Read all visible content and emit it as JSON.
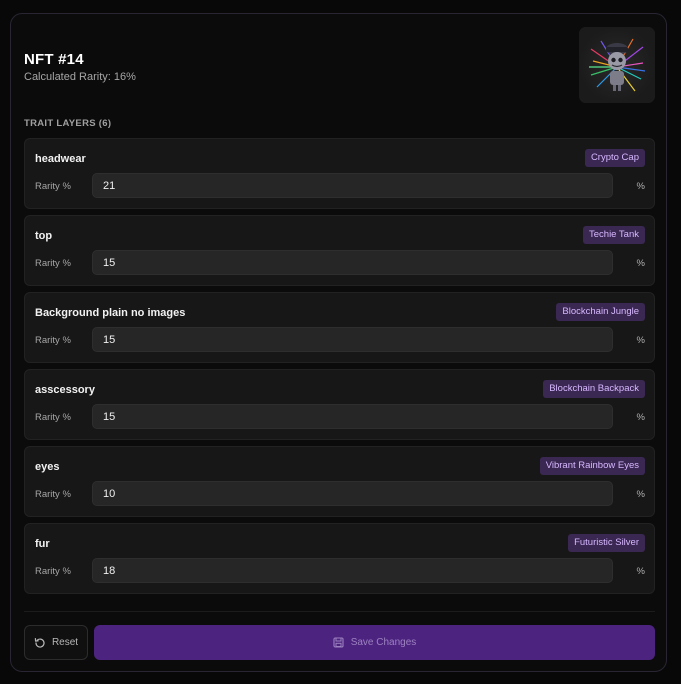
{
  "header": {
    "title": "NFT #14",
    "subtitle": "Calculated Rarity: 16%"
  },
  "thumbnail": {
    "icon": "nft-artwork-image"
  },
  "section": {
    "label": "TRAIT LAYERS (6)"
  },
  "traits": [
    {
      "name": "headwear",
      "value": "Crypto Cap",
      "rarity_label": "Rarity %",
      "rarity": "21",
      "unit": "%"
    },
    {
      "name": "top",
      "value": "Techie Tank",
      "rarity_label": "Rarity %",
      "rarity": "15",
      "unit": "%"
    },
    {
      "name": "Background plain no images",
      "value": "Blockchain Jungle",
      "rarity_label": "Rarity %",
      "rarity": "15",
      "unit": "%"
    },
    {
      "name": "asscessory",
      "value": "Blockchain Backpack",
      "rarity_label": "Rarity %",
      "rarity": "15",
      "unit": "%"
    },
    {
      "name": "eyes",
      "value": "Vibrant Rainbow Eyes",
      "rarity_label": "Rarity %",
      "rarity": "10",
      "unit": "%"
    },
    {
      "name": "fur",
      "value": "Futuristic Silver",
      "rarity_label": "Rarity %",
      "rarity": "18",
      "unit": "%"
    }
  ],
  "actions": {
    "reset_label": "Reset",
    "reset_icon": "undo-icon",
    "save_label": "Save Changes",
    "save_icon": "save-icon"
  },
  "colors": {
    "accent": "#4d2380",
    "badge_bg": "#3a2752",
    "badge_text": "#d7b8ff"
  }
}
